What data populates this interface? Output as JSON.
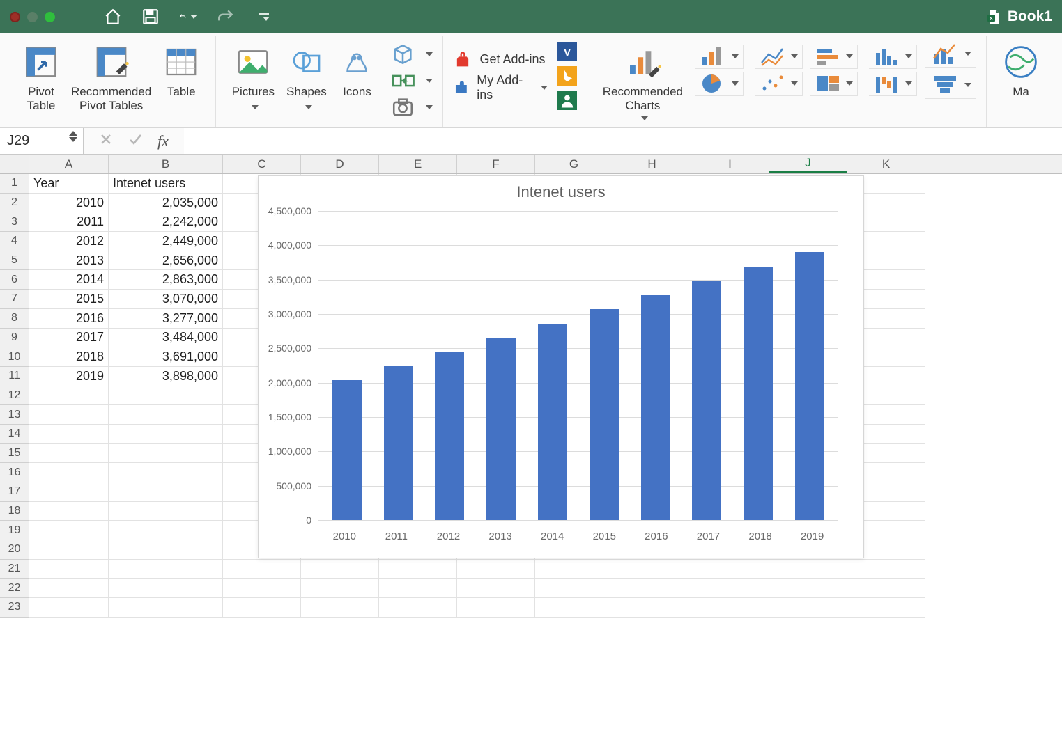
{
  "titlebar": {
    "book_name": "Book1"
  },
  "ribbon": {
    "pivot_table": "Pivot\nTable",
    "rec_pivot": "Recommended\nPivot Tables",
    "table": "Table",
    "pictures": "Pictures",
    "shapes": "Shapes",
    "icons": "Icons",
    "get_addins": "Get Add-ins",
    "my_addins": "My Add-ins",
    "rec_charts": "Recommended\nCharts",
    "maps": "Ma"
  },
  "formula_bar": {
    "name_box": "J29",
    "formula": ""
  },
  "grid": {
    "columns": [
      "A",
      "B",
      "C",
      "D",
      "E",
      "F",
      "G",
      "H",
      "I",
      "J",
      "K"
    ],
    "selected_col": "J",
    "header_row": {
      "A": "Year",
      "B": "Intenet users"
    },
    "rows": [
      {
        "n": 1,
        "A": "Year",
        "B": "Intenet users"
      },
      {
        "n": 2,
        "A": "2010",
        "B": "2,035,000"
      },
      {
        "n": 3,
        "A": "2011",
        "B": "2,242,000"
      },
      {
        "n": 4,
        "A": "2012",
        "B": "2,449,000"
      },
      {
        "n": 5,
        "A": "2013",
        "B": "2,656,000"
      },
      {
        "n": 6,
        "A": "2014",
        "B": "2,863,000"
      },
      {
        "n": 7,
        "A": "2015",
        "B": "3,070,000"
      },
      {
        "n": 8,
        "A": "2016",
        "B": "3,277,000"
      },
      {
        "n": 9,
        "A": "2017",
        "B": "3,484,000"
      },
      {
        "n": 10,
        "A": "2018",
        "B": "3,691,000"
      },
      {
        "n": 11,
        "A": "2019",
        "B": "3,898,000"
      },
      {
        "n": 12
      },
      {
        "n": 13
      },
      {
        "n": 14
      },
      {
        "n": 15
      },
      {
        "n": 16
      },
      {
        "n": 17
      },
      {
        "n": 18
      },
      {
        "n": 19
      },
      {
        "n": 20
      },
      {
        "n": 21
      },
      {
        "n": 22
      },
      {
        "n": 23
      }
    ]
  },
  "chart_data": {
    "type": "bar",
    "title": "Intenet users",
    "categories": [
      "2010",
      "2011",
      "2012",
      "2013",
      "2014",
      "2015",
      "2016",
      "2017",
      "2018",
      "2019"
    ],
    "values": [
      2035000,
      2242000,
      2449000,
      2656000,
      2863000,
      3070000,
      3277000,
      3484000,
      3691000,
      3898000
    ],
    "ylim": [
      0,
      4500000
    ],
    "yticks": [
      0,
      500000,
      1000000,
      1500000,
      2000000,
      2500000,
      3000000,
      3500000,
      4000000,
      4500000
    ],
    "ytick_labels": [
      "0",
      "500,000",
      "1,000,000",
      "1,500,000",
      "2,000,000",
      "2,500,000",
      "3,000,000",
      "3,500,000",
      "4,000,000",
      "4,500,000"
    ],
    "bar_color": "#4472c4"
  }
}
